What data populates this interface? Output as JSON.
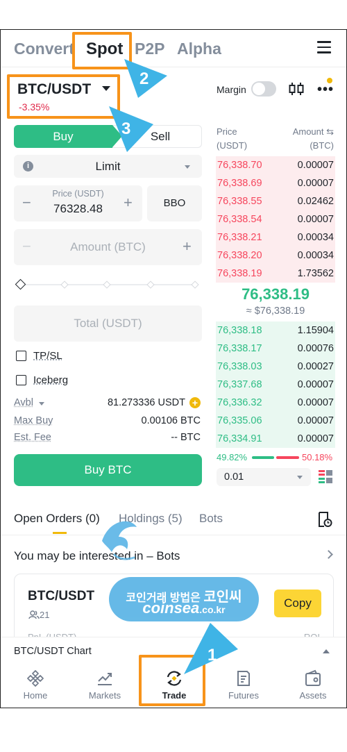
{
  "top_tabs": {
    "convert": "Convert",
    "spot": "Spot",
    "p2p": "P2P",
    "alpha": "Alpha"
  },
  "pair": {
    "symbol": "BTC/USDT",
    "change": "-3.35%"
  },
  "toolbar": {
    "margin_label": "Margin"
  },
  "order_form": {
    "buy_label": "Buy",
    "sell_label": "Sell",
    "order_type": "Limit",
    "price_label": "Price (USDT)",
    "price_value": "76328.48",
    "bbo_label": "BBO",
    "amount_placeholder": "Amount (BTC)",
    "total_placeholder": "Total (USDT)",
    "tpsl_label": "TP/SL",
    "iceberg_label": "Iceberg",
    "avbl_label": "Avbl",
    "avbl_value": "81.273336 USDT",
    "max_buy_label": "Max Buy",
    "max_buy_value": "0.00106 BTC",
    "est_fee_label": "Est. Fee",
    "est_fee_value": "-- BTC",
    "buy_button": "Buy BTC",
    "minus": "−",
    "plus": "+",
    "info_glyph": "i",
    "add_glyph": "+"
  },
  "order_book": {
    "price_header_1": "Price",
    "price_header_2": "(USDT)",
    "amount_header_1": "Amount ⇆",
    "amount_header_2": "(BTC)",
    "asks": [
      {
        "price": "76,338.70",
        "amount": "0.00007"
      },
      {
        "price": "76,338.69",
        "amount": "0.00007"
      },
      {
        "price": "76,338.55",
        "amount": "0.02462"
      },
      {
        "price": "76,338.54",
        "amount": "0.00007"
      },
      {
        "price": "76,338.21",
        "amount": "0.00034"
      },
      {
        "price": "76,338.20",
        "amount": "0.00034"
      },
      {
        "price": "76,338.19",
        "amount": "1.73562"
      }
    ],
    "mid_price": "76,338.19",
    "mid_usd": "≈ $76,338.19",
    "bids": [
      {
        "price": "76,338.18",
        "amount": "1.15904"
      },
      {
        "price": "76,338.17",
        "amount": "0.00076"
      },
      {
        "price": "76,338.03",
        "amount": "0.00027"
      },
      {
        "price": "76,337.68",
        "amount": "0.00007"
      },
      {
        "price": "76,336.32",
        "amount": "0.00007"
      },
      {
        "price": "76,335.06",
        "amount": "0.00007"
      },
      {
        "price": "76,334.91",
        "amount": "0.00007"
      }
    ],
    "buy_ratio": "49.82%",
    "sell_ratio": "50.18%",
    "precision": "0.01"
  },
  "lower_tabs": {
    "open_orders": "Open Orders (0)",
    "holdings": "Holdings (5)",
    "bots": "Bots"
  },
  "promo": {
    "headline": "You may be interested in – Bots",
    "card_title": "BTC/USDT",
    "card_users": "21",
    "copy_button": "Copy",
    "card_cut_left": "PnL (USDT)",
    "card_cut_right": "ROI"
  },
  "chart_bar": {
    "label": "BTC/USDT Chart"
  },
  "bottom_nav": [
    {
      "label": "Home",
      "icon": "home-icon"
    },
    {
      "label": "Markets",
      "icon": "markets-icon"
    },
    {
      "label": "Trade",
      "icon": "trade-icon"
    },
    {
      "label": "Futures",
      "icon": "futures-icon"
    },
    {
      "label": "Assets",
      "icon": "assets-icon"
    }
  ],
  "annotations": {
    "step1": "1",
    "step2": "2",
    "step3": "3"
  },
  "watermark": {
    "line1_a": "코인거래 방법은 ",
    "line1_b": "코인씨",
    "line2_main": "coinsea",
    "line2_tld": ".co.kr"
  },
  "colors": {
    "buy_green": "#2ebd85",
    "sell_red": "#f6465d",
    "accent_yellow": "#f0b90b",
    "annotation_orange": "#f7931a",
    "annotation_blue": "#3fb4e6"
  }
}
